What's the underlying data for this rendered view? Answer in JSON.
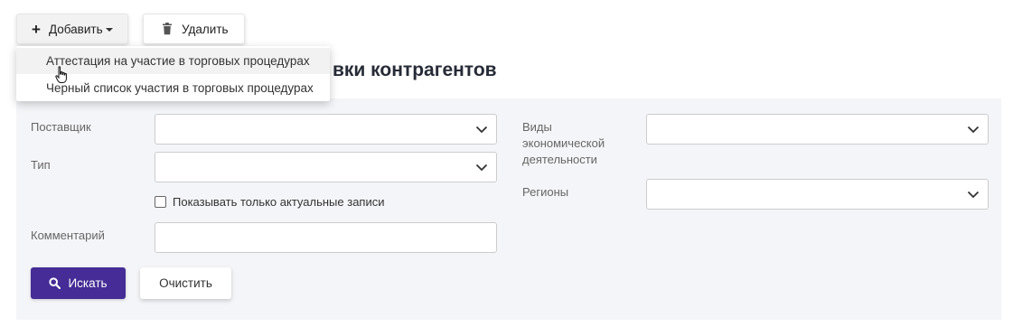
{
  "toolbar": {
    "add_label": "Добавить",
    "delete_label": "Удалить"
  },
  "page": {
    "title": "вки контрагентов"
  },
  "add_menu": {
    "items": [
      {
        "label": "Аттестация на участие в торговых процедурах"
      },
      {
        "label": "Черный список участия в торговых процедурах"
      }
    ]
  },
  "filters": {
    "supplier_label": "Поставщик",
    "supplier_value": "",
    "type_label": "Тип",
    "type_value": "",
    "actual_only_label": "Показывать только актуальные записи",
    "actual_only_checked": false,
    "comment_label": "Комментарий",
    "comment_value": "",
    "activity_label_line1": "Виды",
    "activity_label_line2": "экономической",
    "activity_label_line3": "деятельности",
    "activity_value": "",
    "regions_label": "Регионы",
    "regions_value": ""
  },
  "actions": {
    "search_label": "Искать",
    "clear_label": "Очистить"
  },
  "colors": {
    "primary": "#452c96",
    "panel_bg": "#f4f5f8"
  },
  "icons": [
    "plus-icon",
    "caret-down-icon",
    "trash-icon",
    "chevron-down-icon",
    "search-icon",
    "hand-cursor-icon"
  ]
}
